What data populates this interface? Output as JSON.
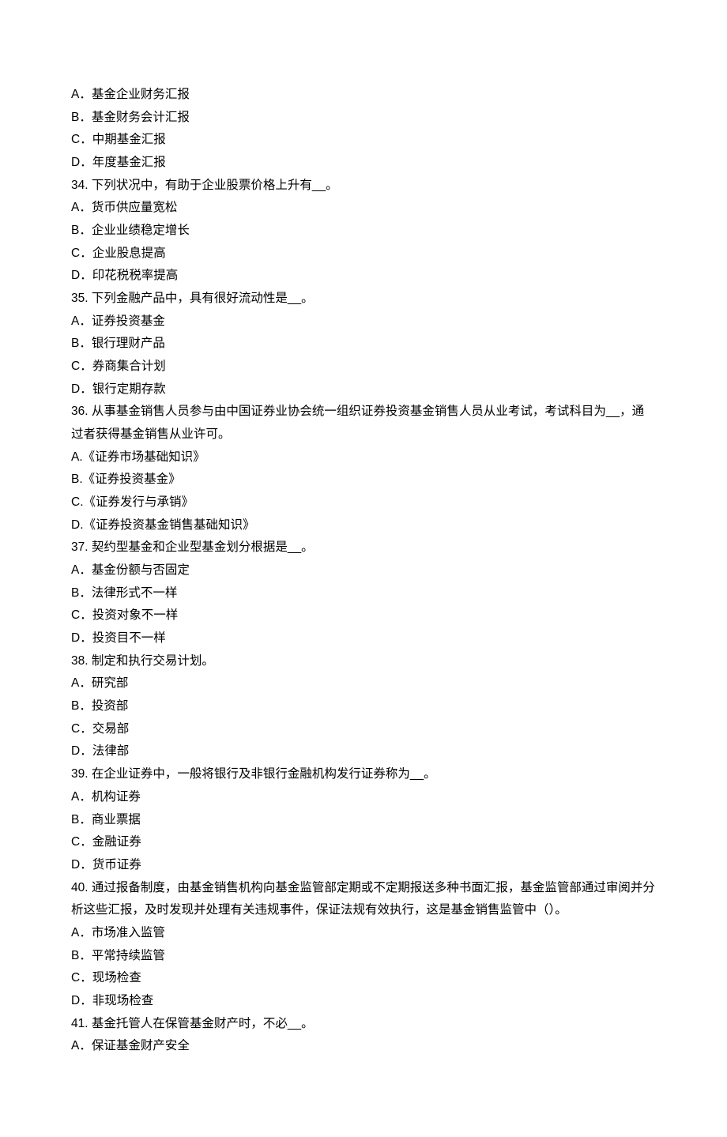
{
  "q33": {
    "options": {
      "a": "A．基金企业财务汇报",
      "b": "B．基金财务会计汇报",
      "c": "C．中期基金汇报",
      "d": "D．年度基金汇报"
    }
  },
  "q34": {
    "stem": "34. 下列状况中，有助于企业股票价格上升有__。",
    "options": {
      "a": "A．货币供应量宽松",
      "b": "B．企业业绩稳定增长",
      "c": "C．企业股息提高",
      "d": "D．印花税税率提高"
    }
  },
  "q35": {
    "stem": "35. 下列金融产品中，具有很好流动性是__。",
    "options": {
      "a": "A．证券投资基金",
      "b": "B．银行理财产品",
      "c": "C．券商集合计划",
      "d": "D．银行定期存款"
    }
  },
  "q36": {
    "stem": "36. 从事基金销售人员参与由中国证券业协会统一组织证券投资基金销售人员从业考试，考试科目为__，通过者获得基金销售从业许可。",
    "options": {
      "a": "A.《证券市场基础知识》",
      "b": "B.《证券投资基金》",
      "c": "C.《证券发行与承销》",
      "d": "D.《证券投资基金销售基础知识》"
    }
  },
  "q37": {
    "stem": "37. 契约型基金和企业型基金划分根据是__。",
    "options": {
      "a": "A．基金份额与否固定",
      "b": "B．法律形式不一样",
      "c": "C．投资对象不一样",
      "d": "D．投资目不一样"
    }
  },
  "q38": {
    "stem": "38. 制定和执行交易计划。",
    "options": {
      "a": "A．研究部",
      "b": "B．投资部",
      "c": "C．交易部",
      "d": "D．法律部"
    }
  },
  "q39": {
    "stem": "39. 在企业证券中，一般将银行及非银行金融机构发行证券称为__。",
    "options": {
      "a": "A．机构证券",
      "b": "B．商业票据",
      "c": "C．金融证券",
      "d": "D．货币证券"
    }
  },
  "q40": {
    "stem": "40. 通过报备制度，由基金销售机构向基金监管部定期或不定期报送多种书面汇报，基金监管部通过审阅并分析这些汇报，及时发现并处理有关违规事件，保证法规有效执行，这是基金销售监管中（）。",
    "options": {
      "a": "A．市场准入监管",
      "b": "B．平常持续监管",
      "c": "C．现场检查",
      "d": "D．非现场检查"
    }
  },
  "q41": {
    "stem": "41. 基金托管人在保管基金财产时，不必__。",
    "options": {
      "a": "A．保证基金财产安全"
    }
  }
}
